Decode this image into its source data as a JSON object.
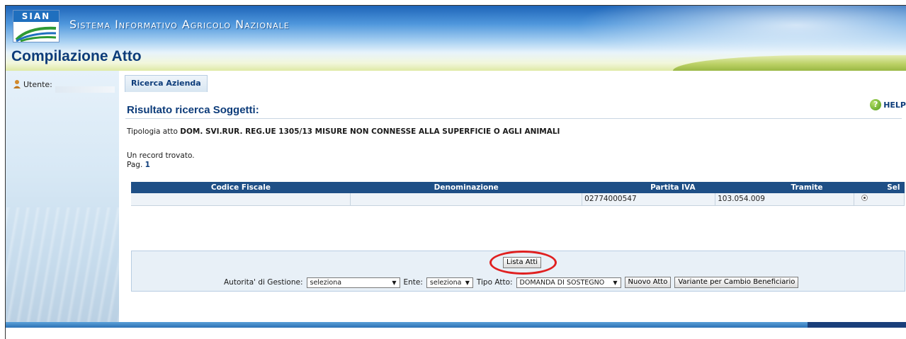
{
  "header": {
    "logo_text": "SIAN",
    "app_title": "Sistema Informativo Agricolo Nazionale",
    "page_title": "Compilazione Atto"
  },
  "sidebar": {
    "user_label": "Utente:"
  },
  "main": {
    "tab_label": "Ricerca Azienda",
    "section_title": "Risultato ricerca Soggetti:",
    "help_label": "HELP",
    "tipologia_label": "Tipologia atto",
    "tipologia_value": "DOM. SVI.RUR. REG.UE 1305/13 MISURE NON CONNESSE ALLA SUPERFICIE O AGLI ANIMALI",
    "record_text": "Un record trovato.",
    "pag_label": "Pag.",
    "pag_value": "1"
  },
  "table": {
    "columns": [
      "Codice Fiscale",
      "Denominazione",
      "Partita IVA",
      "Tramite",
      "Sel"
    ],
    "rows": [
      {
        "codice_fiscale": "",
        "denominazione": "",
        "partita_iva": "02774000547",
        "tramite": "103.054.009",
        "sel": true
      }
    ]
  },
  "actions": {
    "lista_atti_button": "Lista Atti",
    "autorita_label": "Autorita' di Gestione:",
    "autorita_value": "seleziona",
    "ente_label": "Ente:",
    "ente_value": "seleziona",
    "tipo_atto_label": "Tipo Atto:",
    "tipo_atto_value": "DOMANDA DI SOSTEGNO",
    "nuovo_atto_button": "Nuovo Atto",
    "variante_button": "Variante per Cambio Beneficiario"
  },
  "colors": {
    "header_blue": "#1d64b8",
    "title_navy": "#0d3c7a",
    "table_header": "#1e4f86",
    "highlight_red": "#e02020"
  }
}
